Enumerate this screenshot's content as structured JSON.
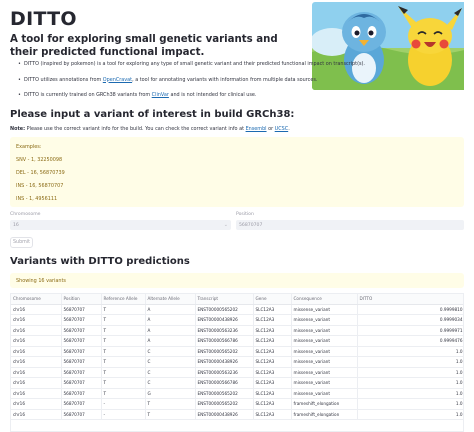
{
  "app": {
    "title": "DITTO",
    "subtitle": "A tool for exploring small genetic variants and their predicted functional impact."
  },
  "intro": {
    "bullet1": "DITTO (inspired by pokemon) is a tool for exploring any type of small genetic variant and their predicted functional impact on transcript(s).",
    "bullet2_pre": "DITTO utilizes annotations from ",
    "bullet2_link": "OpenCravat",
    "bullet2_post": ", a tool for annotating variants with information from multiple data sources.",
    "bullet3_pre": "DITTO is currently trained on GRCh38 variants from ",
    "bullet3_link": "ClinVar",
    "bullet3_post": " and is not intended for clinical use."
  },
  "input_section": {
    "heading": "Please input a variant of interest in build GRCh38:",
    "note_bold": "Note:",
    "note_pre": " Please use the correct variant info for the build. You can check the correct variant info at ",
    "note_link1": "Ensembl",
    "note_mid": " or ",
    "note_link2": "UCSC",
    "note_end": "."
  },
  "examples": {
    "title": "Examples:",
    "snv": "SNV - 1, 32250098",
    "del": "DEL - 16, 56870739",
    "ins": "INS - 16, 56870707",
    "ins2": "INS - 1, 4956111"
  },
  "form": {
    "chromosome_label": "Chromosome",
    "chromosome_value": "16",
    "position_label": "Position",
    "position_value": "56870707",
    "submit_label": "Submit"
  },
  "results": {
    "heading": "Variants with DITTO predictions",
    "count_text": "Showing 16 variants",
    "columns": [
      "Chromosome",
      "Position",
      "Reference Allele",
      "Alternate Allele",
      "Transcript",
      "Gene",
      "Consequence",
      "DITTO"
    ],
    "rows": [
      [
        "chr16",
        "56870707",
        "T",
        "A",
        "ENST00000565202",
        "SLC12A3",
        "missense_variant",
        "0.9999810"
      ],
      [
        "chr16",
        "56870707",
        "T",
        "A",
        "ENST00000438926",
        "SLC12A3",
        "missense_variant",
        "0.9999034"
      ],
      [
        "chr16",
        "56870707",
        "T",
        "A",
        "ENST00000563236",
        "SLC12A3",
        "missense_variant",
        "0.9999971"
      ],
      [
        "chr16",
        "56870707",
        "T",
        "A",
        "ENST00000566786",
        "SLC12A3",
        "missense_variant",
        "0.9999476"
      ],
      [
        "chr16",
        "56870707",
        "T",
        "C",
        "ENST00000565202",
        "SLC12A3",
        "missense_variant",
        "1.0"
      ],
      [
        "chr16",
        "56870707",
        "T",
        "C",
        "ENST00000438926",
        "SLC12A3",
        "missense_variant",
        "1.0"
      ],
      [
        "chr16",
        "56870707",
        "T",
        "C",
        "ENST00000563236",
        "SLC12A3",
        "missense_variant",
        "1.0"
      ],
      [
        "chr16",
        "56870707",
        "T",
        "C",
        "ENST00000566786",
        "SLC12A3",
        "missense_variant",
        "1.0"
      ],
      [
        "chr16",
        "56870707",
        "T",
        "G",
        "ENST00000565202",
        "SLC12A3",
        "missense_variant",
        "1.0"
      ],
      [
        "chr16",
        "56870707",
        "-",
        "T",
        "ENST00000565202",
        "SLC12A3",
        "frameshift_elongation",
        "1.0"
      ],
      [
        "chr16",
        "56870707",
        "-",
        "T",
        "ENST00000438926",
        "SLC12A3",
        "frameshift_elongation",
        "1.0"
      ]
    ]
  },
  "colors": {
    "info_bg": "#fffde7",
    "info_text": "#8a6a14",
    "link": "#1c6ab1",
    "input_bg": "#f0f2f6"
  },
  "icons": {
    "select_chevron": "chevron-down-icon",
    "hero_image": "pokemon-illustration"
  }
}
